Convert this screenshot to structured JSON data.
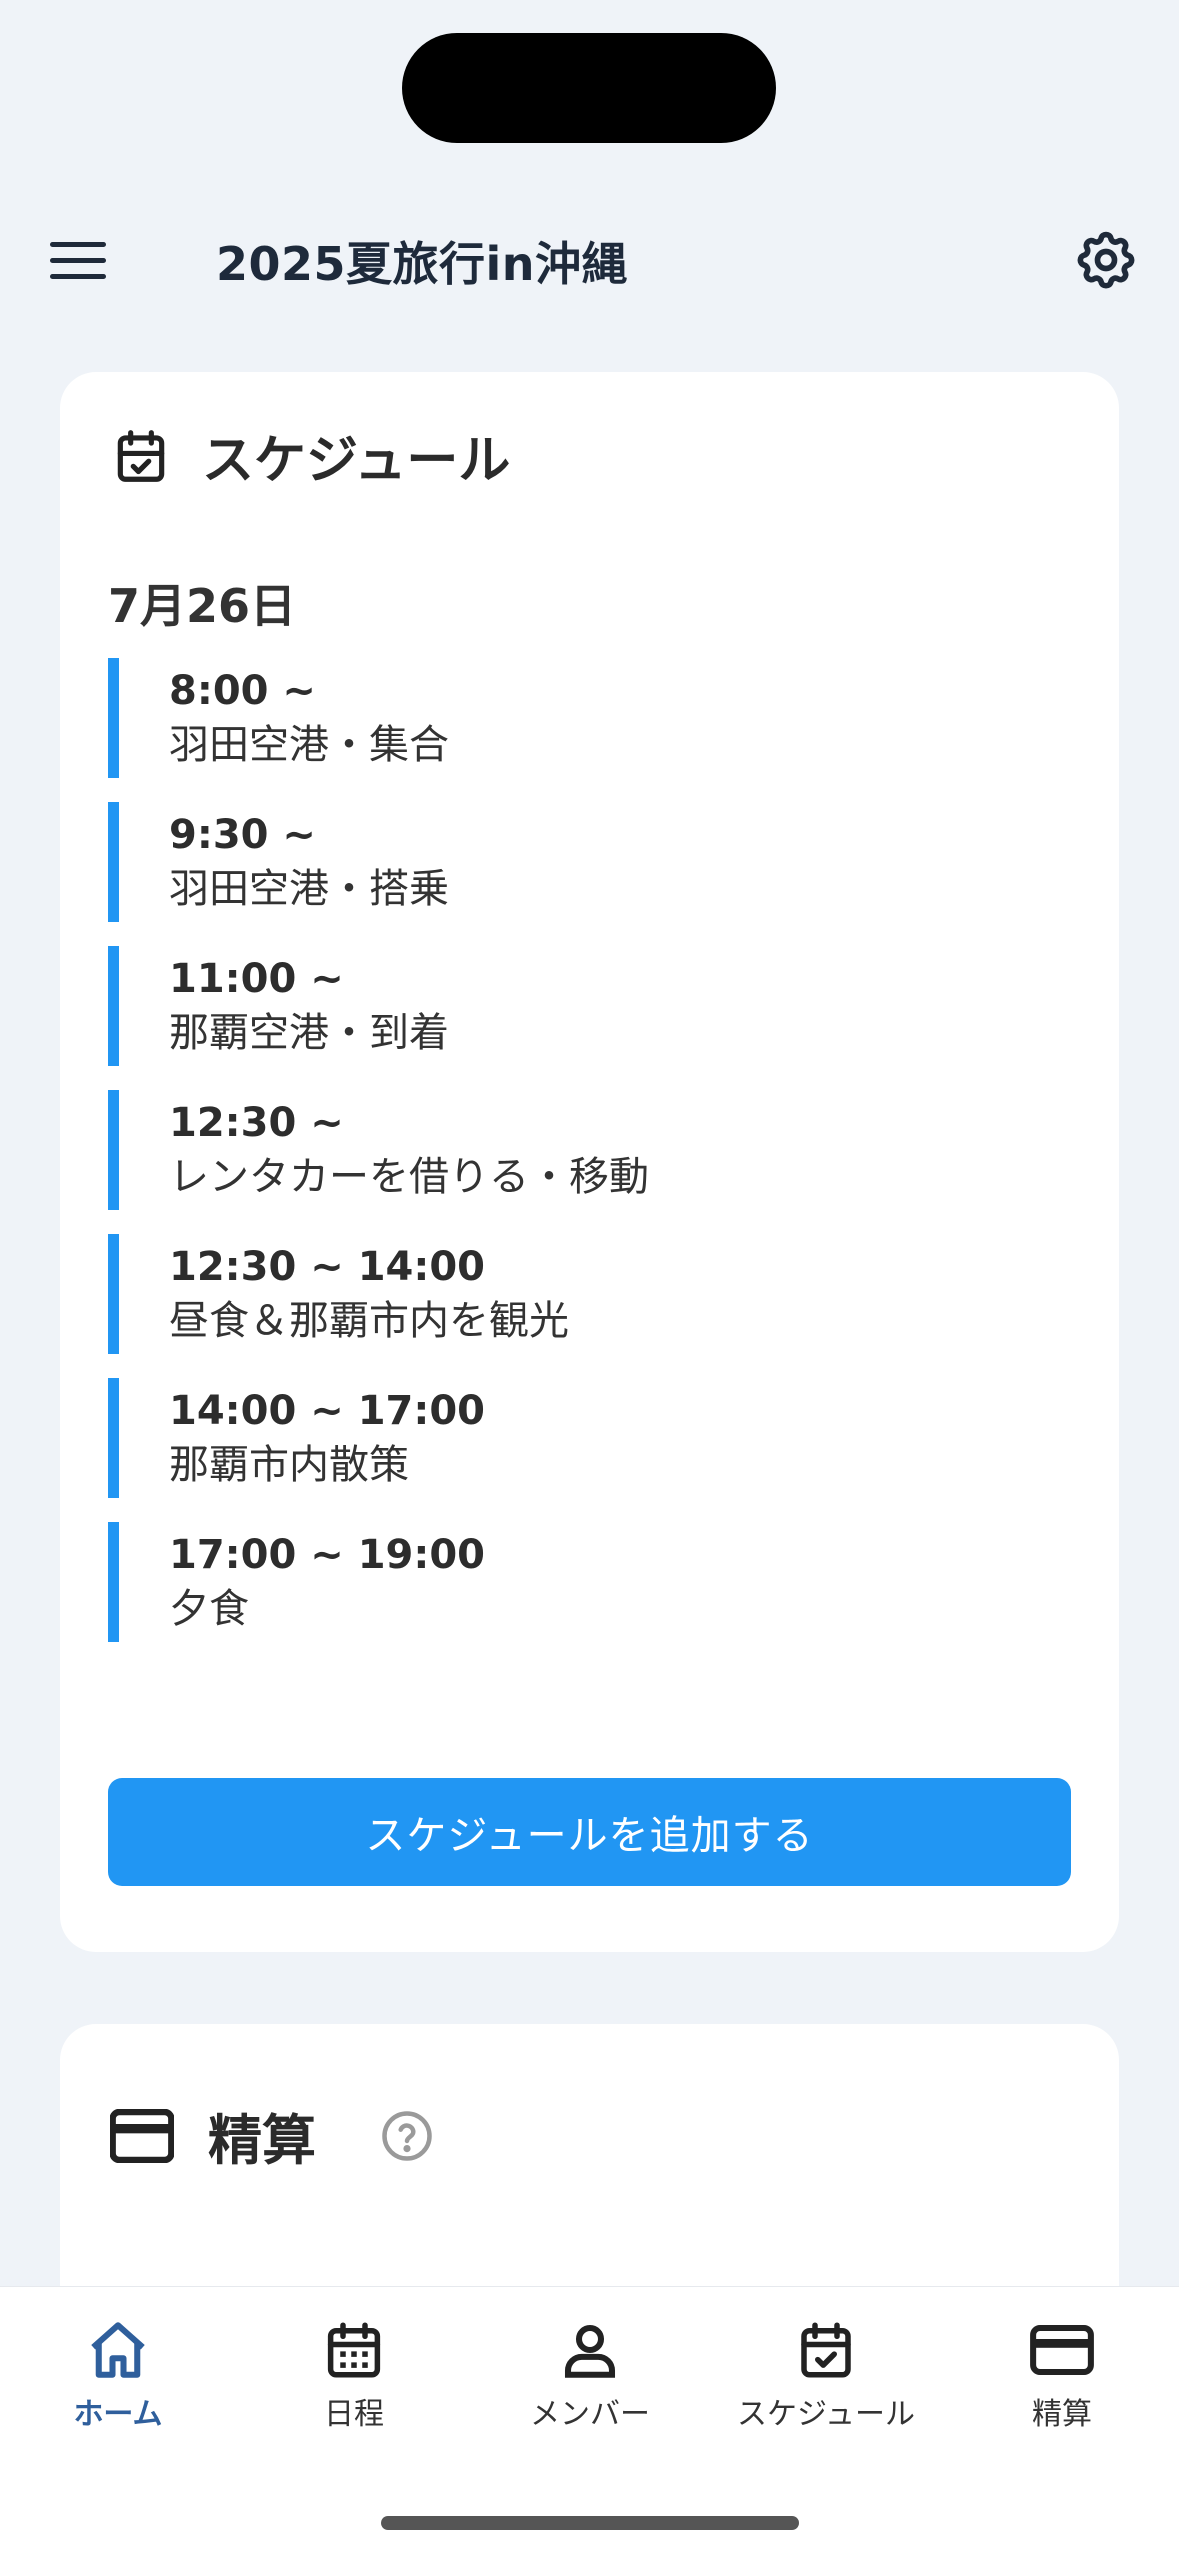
{
  "header": {
    "title": "2025夏旅行in沖縄"
  },
  "schedule": {
    "heading": "スケジュール",
    "date": "7月26日",
    "items": [
      {
        "time": "8:00 ~",
        "title": "羽田空港・集合"
      },
      {
        "time": "9:30 ~",
        "title": "羽田空港・搭乗"
      },
      {
        "time": "11:00 ~",
        "title": "那覇空港・到着"
      },
      {
        "time": "12:30 ~",
        "title": "レンタカーを借りる・移動"
      },
      {
        "time": "12:30 ~ 14:00",
        "title": "昼食＆那覇市内を観光"
      },
      {
        "time": "14:00 ~ 17:00",
        "title": "那覇市内散策"
      },
      {
        "time": "17:00 ~ 19:00",
        "title": "夕食"
      }
    ],
    "add_button": "スケジュールを追加する"
  },
  "settlement": {
    "heading": "精算"
  },
  "nav": [
    {
      "label": "ホーム",
      "icon": "home-icon",
      "active": true
    },
    {
      "label": "日程",
      "icon": "calendar-grid-icon",
      "active": false
    },
    {
      "label": "メンバー",
      "icon": "person-icon",
      "active": false
    },
    {
      "label": "スケジュール",
      "icon": "calendar-check-icon",
      "active": false
    },
    {
      "label": "精算",
      "icon": "credit-card-icon",
      "active": false
    }
  ],
  "colors": {
    "accent": "#2196f3",
    "active_nav": "#2f5f9c",
    "text_dark": "#1e2a3b"
  }
}
